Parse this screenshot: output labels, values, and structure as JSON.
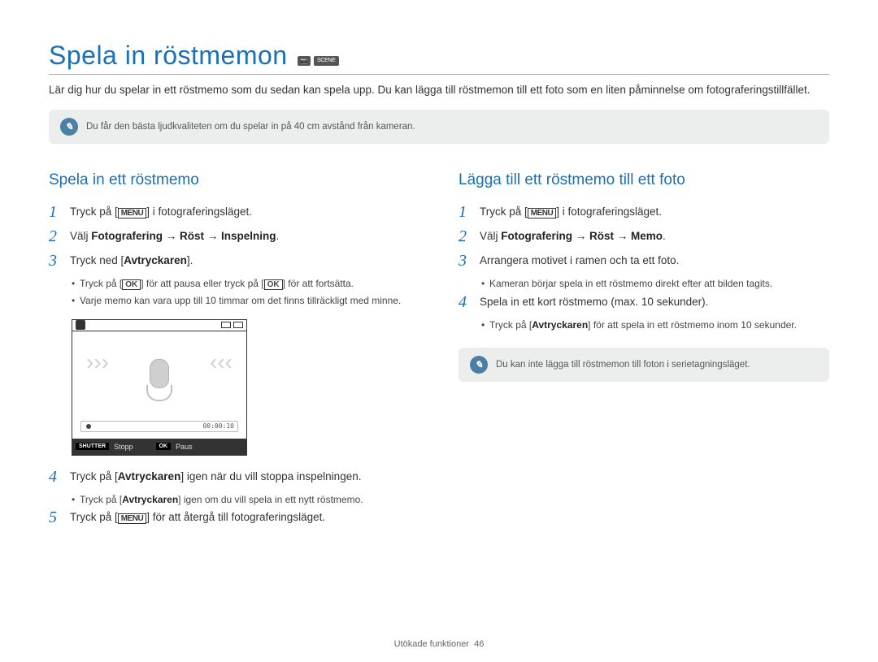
{
  "page_title": "Spela in röstmemon",
  "intro": "Lär dig hur du spelar in ett röstmemo som du sedan kan spela upp. Du kan lägga till röstmemon till ett foto som en liten påminnelse om fotograferingstillfället.",
  "top_note": "Du får den bästa ljudkvaliteten om du spelar in på 40 cm avstånd från kameran.",
  "mode_icons": [
    "📷",
    "SCENE"
  ],
  "left": {
    "heading": "Spela in ett röstmemo",
    "step1_pre": "Tryck på [",
    "step1_key": "MENU",
    "step1_post": "] i fotograferingsläget.",
    "step2": "Välj ",
    "step2_path": "Fotografering → Röst → Inspelning",
    "step2_end": ".",
    "step3_pre": "Tryck ned [",
    "step3_key": "Avtryckaren",
    "step3_post": "].",
    "step3_b1_a": "Tryck på [",
    "step3_b1_ok": "OK",
    "step3_b1_b": "] för att pausa eller tryck på [",
    "step3_b1_c": "] för att fortsätta.",
    "step3_b2": "Varje memo kan vara upp till 10 timmar om det finns tillräckligt med minne.",
    "screen": {
      "time": "00:00:10",
      "shutter_label": "SHUTTER",
      "stop": "Stopp",
      "ok_label": "OK",
      "pause": "Paus"
    },
    "step4_pre": "Tryck på [",
    "step4_key": "Avtryckaren",
    "step4_post": "] igen när du vill stoppa inspelningen.",
    "step4_b1_a": "Tryck på [",
    "step4_b1_key": "Avtryckaren",
    "step4_b1_b": "] igen om du vill spela in ett nytt röstmemo.",
    "step5_pre": "Tryck på [",
    "step5_key": "MENU",
    "step5_post": "] för att återgå till fotograferingsläget."
  },
  "right": {
    "heading": "Lägga till ett röstmemo till ett foto",
    "step1_pre": "Tryck på [",
    "step1_key": "MENU",
    "step1_post": "] i fotograferingsläget.",
    "step2": "Välj ",
    "step2_path": "Fotografering → Röst → Memo",
    "step2_end": ".",
    "step3": "Arrangera motivet i ramen och ta ett foto.",
    "step3_b1": "Kameran börjar spela in ett röstmemo direkt efter att bilden tagits.",
    "step4": "Spela in ett kort röstmemo (max. 10 sekunder).",
    "step4_b1_a": "Tryck på [",
    "step4_b1_key": "Avtryckaren",
    "step4_b1_b": "] för att spela in ett röstmemo inom 10 sekunder.",
    "note": "Du kan inte lägga till röstmemon till foton i serietagningsläget."
  },
  "footer_section": "Utökade funktioner",
  "footer_page": "46"
}
